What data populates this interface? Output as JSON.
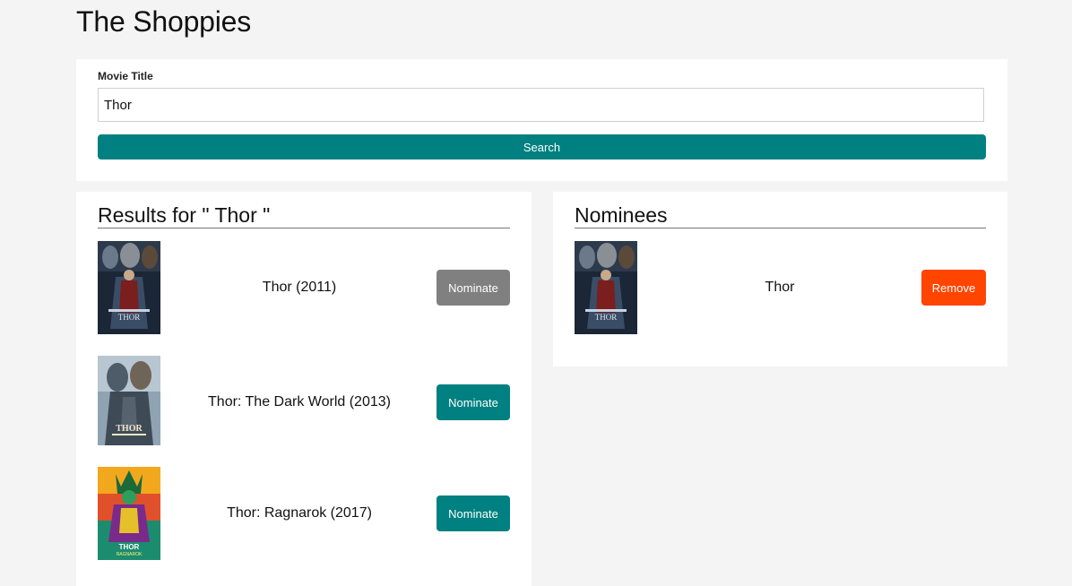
{
  "app": {
    "title": "The Shoppies"
  },
  "search": {
    "label": "Movie Title",
    "value": "Thor",
    "button_label": "Search"
  },
  "results": {
    "heading": "Results for \" Thor \"",
    "items": [
      {
        "title": "Thor (2011)",
        "button_label": "Nominate",
        "nominated": true
      },
      {
        "title": "Thor: The Dark World (2013)",
        "button_label": "Nominate",
        "nominated": false
      },
      {
        "title": "Thor: Ragnarok (2017)",
        "button_label": "Nominate",
        "nominated": false
      }
    ]
  },
  "nominees": {
    "heading": "Nominees",
    "items": [
      {
        "title": "Thor",
        "button_label": "Remove"
      }
    ]
  },
  "colors": {
    "page_bg": "#f4f4f4",
    "card_bg": "#ffffff",
    "primary": "#008080",
    "disabled": "#808080",
    "danger": "#ff4500"
  }
}
